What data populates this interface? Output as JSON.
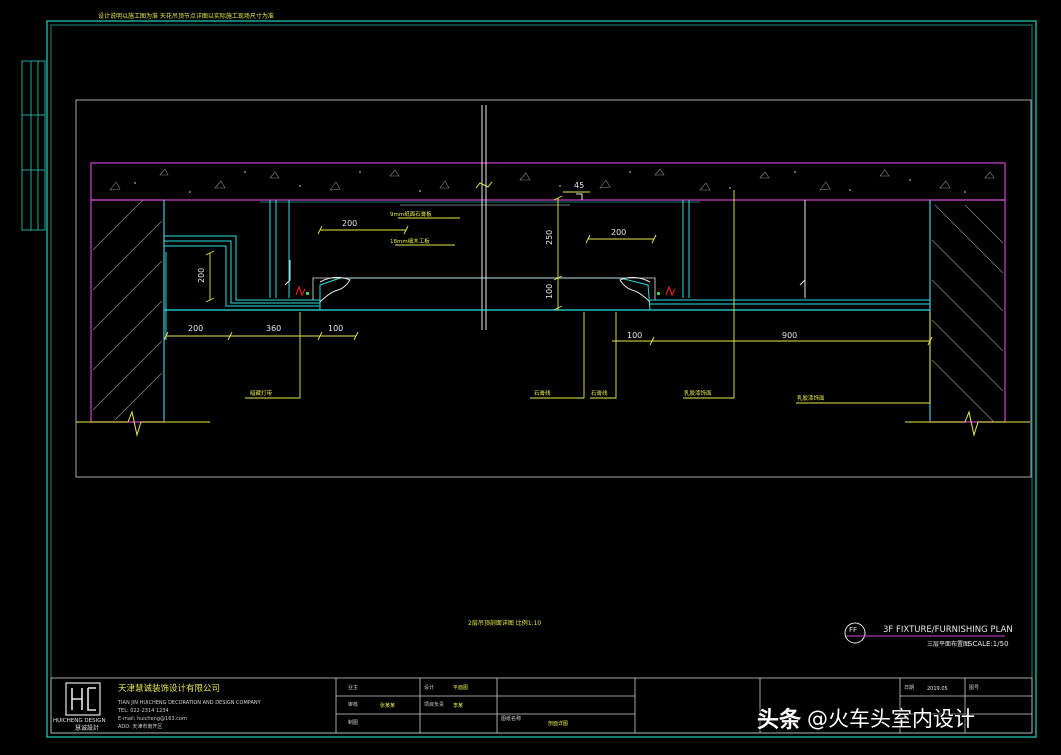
{
  "top_note": "设计说明以施工图为准 天花吊顶节点详图以实际施工现场尺寸为准",
  "dimensions": {
    "d200_top": "200",
    "d45": "45",
    "d250": "250",
    "d200_mid": "200",
    "d200_vert": "200",
    "d100_vert": "100",
    "d200_bottom": "200",
    "d360": "360",
    "d100_a": "100",
    "d100_b": "100",
    "d900": "900"
  },
  "callouts": {
    "gypsum_9": "9mm纸面石膏板",
    "board_18": "18mm细木工板",
    "label_1": "暗藏灯带",
    "label_2": "石膏线",
    "label_3": "石膏线",
    "label_4": "乳胶漆饰面",
    "label_5": "乳胶漆饰面"
  },
  "caption": "2层吊顶剖面详图 比例1:10",
  "plan": {
    "symbol": "FF",
    "title": "3F FIXTURE/FURNISHING PLAN",
    "subtitle": "三层平面布置图",
    "scale": "SCALE:1/50"
  },
  "title_block": {
    "company_cn": "天津慧诚装饰设计有限公司",
    "company_en": "TIAN JIN HUICHENG DECORATION AND DESIGN COMPANY",
    "tel": "TEL: 022-2314 1234",
    "web": "E-mail: huicheng@163.com",
    "addr": "ADD: 天津市南开区",
    "logo_sub": "HUICHENG DESIGN",
    "logo_cn": "慧诚設計",
    "cells": {
      "c1": "业主",
      "c2": "设计",
      "c3": "平面图",
      "c4": "审核",
      "c5": "张某某",
      "c6": "项目负责",
      "c7": "李某",
      "c8": "制图",
      "c9": "图纸名称",
      "c10": "剖面详图",
      "c11": "日期",
      "c12": "2019.05",
      "c13": "图号"
    }
  },
  "watermark": {
    "brand": "头条",
    "handle": "@火车头室内设计"
  },
  "colors": {
    "frame": "#1fa89a",
    "concrete": "#d040d0",
    "cyan": "#29e0e0",
    "yellow": "#e8e84a",
    "white": "#e6e6e6",
    "red": "#e02020",
    "green": "#3fd03f",
    "title_frame": "#cfcfcf"
  }
}
